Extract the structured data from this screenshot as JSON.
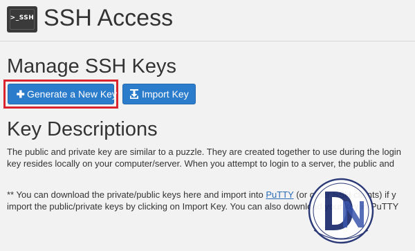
{
  "header": {
    "icon_label": ">_SSH",
    "title": "SSH Access"
  },
  "manage": {
    "heading": "Manage SSH Keys",
    "buttons": {
      "generate_label": "Generate a New Key",
      "import_label": "Import Key"
    }
  },
  "descriptions": {
    "heading": "Key Descriptions",
    "line_1": "The public and private key are similar to a puzzle. They are created together to use during the login",
    "line_2": "key resides locally on your computer/server. When you attempt to login to a server, the public and",
    "line_3_before": "** You can download the private/public keys here and import into ",
    "line_3_link": "PuTTY",
    "line_3_after": " (or other SSH clients) if y",
    "line_4": "import the public/private keys by clicking on Import Key. You can also download your key in PuTTY"
  },
  "watermark": {
    "logo_letters": "DN"
  },
  "colors": {
    "background": "#f2f2f2",
    "button_blue": "#2c7ccc",
    "highlight_red": "#d9232e",
    "link_blue": "#2a6bb8",
    "logo_navy": "#1c2b6e"
  },
  "icons": {
    "header": "terminal-ssh-icon",
    "generate": "plus-icon",
    "import": "import-upload-icon"
  }
}
